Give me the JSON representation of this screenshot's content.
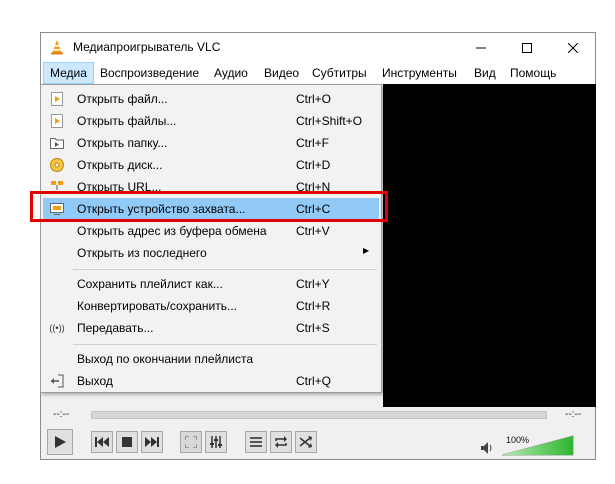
{
  "window": {
    "title": "Медиапроигрыватель VLC"
  },
  "menubar": {
    "items": [
      "Медиа",
      "Воспроизведение",
      "Аудио",
      "Видео",
      "Субтитры",
      "Инструменты",
      "Вид",
      "Помощь"
    ]
  },
  "media_menu": {
    "items": [
      {
        "label": "Открыть файл...",
        "shortcut": "Ctrl+O",
        "icon": "file-icon"
      },
      {
        "label": "Открыть файлы...",
        "shortcut": "Ctrl+Shift+O",
        "icon": "files-icon"
      },
      {
        "label": "Открыть папку...",
        "shortcut": "Ctrl+F",
        "icon": "folder-icon"
      },
      {
        "label": "Открыть диск...",
        "shortcut": "Ctrl+D",
        "icon": "disc-icon"
      },
      {
        "label": "Открыть URL...",
        "shortcut": "Ctrl+N",
        "icon": "network-icon"
      },
      {
        "label": "Открыть устройство захвата...",
        "shortcut": "Ctrl+C",
        "icon": "capture-device-icon"
      },
      {
        "label": "Открыть адрес из буфера обмена",
        "shortcut": "Ctrl+V",
        "icon": ""
      },
      {
        "label": "Открыть из последнего",
        "shortcut": "",
        "icon": ""
      },
      {
        "label": "Сохранить плейлист как...",
        "shortcut": "Ctrl+Y",
        "icon": ""
      },
      {
        "label": "Конвертировать/сохранить...",
        "shortcut": "Ctrl+R",
        "icon": ""
      },
      {
        "label": "Передавать...",
        "shortcut": "Ctrl+S",
        "icon": "stream-icon"
      },
      {
        "label": "Выход по окончании плейлиста",
        "shortcut": "",
        "icon": ""
      },
      {
        "label": "Выход",
        "shortcut": "Ctrl+Q",
        "icon": "exit-icon"
      }
    ],
    "highlighted_index": 5
  },
  "player": {
    "time_elapsed": "--:--",
    "time_total": "--:--",
    "volume_label": "100%",
    "volume_level": 1.0
  },
  "colors": {
    "highlight": "#91c9f7",
    "annotation_box": "#e00000",
    "volume_fill": "#2fb52f"
  }
}
